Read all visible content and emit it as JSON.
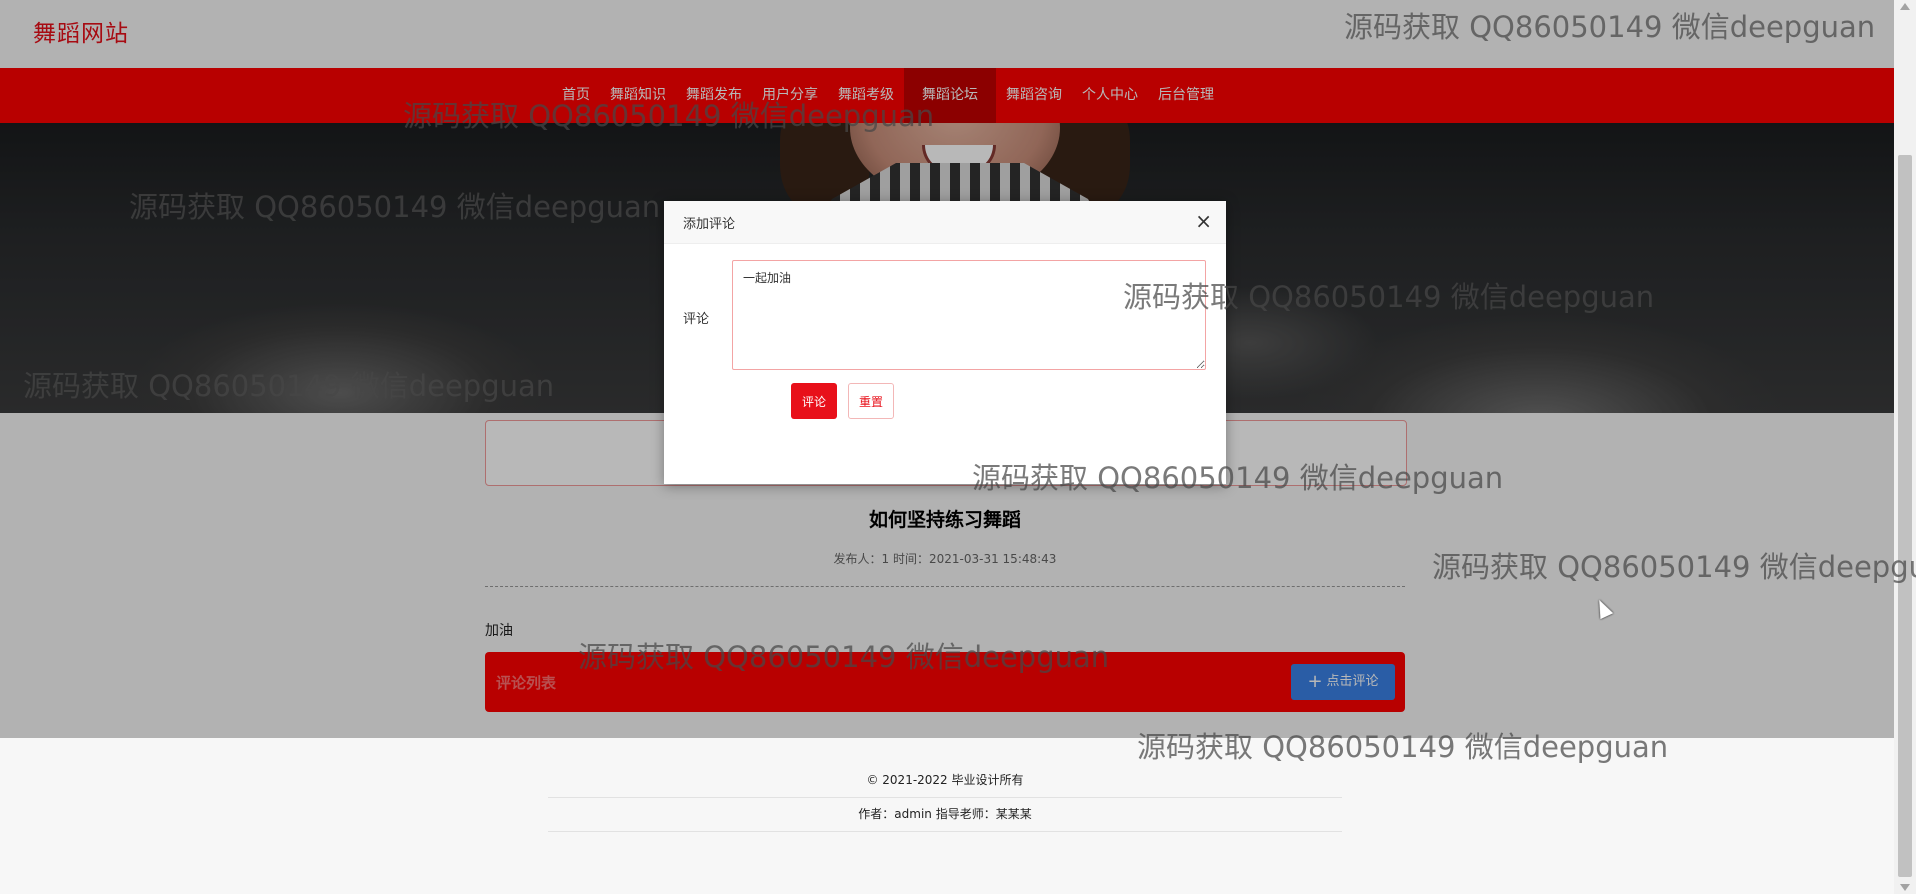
{
  "site": {
    "logo": "舞蹈网站"
  },
  "nav": {
    "items": [
      {
        "label": "首页"
      },
      {
        "label": "舞蹈知识"
      },
      {
        "label": "舞蹈发布"
      },
      {
        "label": "用户分享"
      },
      {
        "label": "舞蹈考级"
      },
      {
        "label": "舞蹈论坛",
        "active": true
      },
      {
        "label": "舞蹈咨询"
      },
      {
        "label": "个人中心"
      },
      {
        "label": "后台管理"
      }
    ]
  },
  "post": {
    "title": "如何坚持练习舞蹈",
    "meta": "发布人：1 时间：2021-03-31 15:48:43",
    "content": "加油"
  },
  "comments": {
    "title": "评论列表",
    "add_button": "点击评论"
  },
  "modal": {
    "title": "添加评论",
    "close": "×",
    "field_label": "评论",
    "input_value": "一起加油",
    "submit_label": "评论",
    "reset_label": "重置"
  },
  "footer": {
    "copyright": "© 2021-2022 毕业设计所有",
    "author": "作者：admin 指导老师：某某某"
  },
  "watermark": "源码获取 QQ86050149 微信deepguan",
  "colors": {
    "brand": "#ff0000",
    "nav_active": "#c30000",
    "button_blue": "#3b82e6"
  }
}
